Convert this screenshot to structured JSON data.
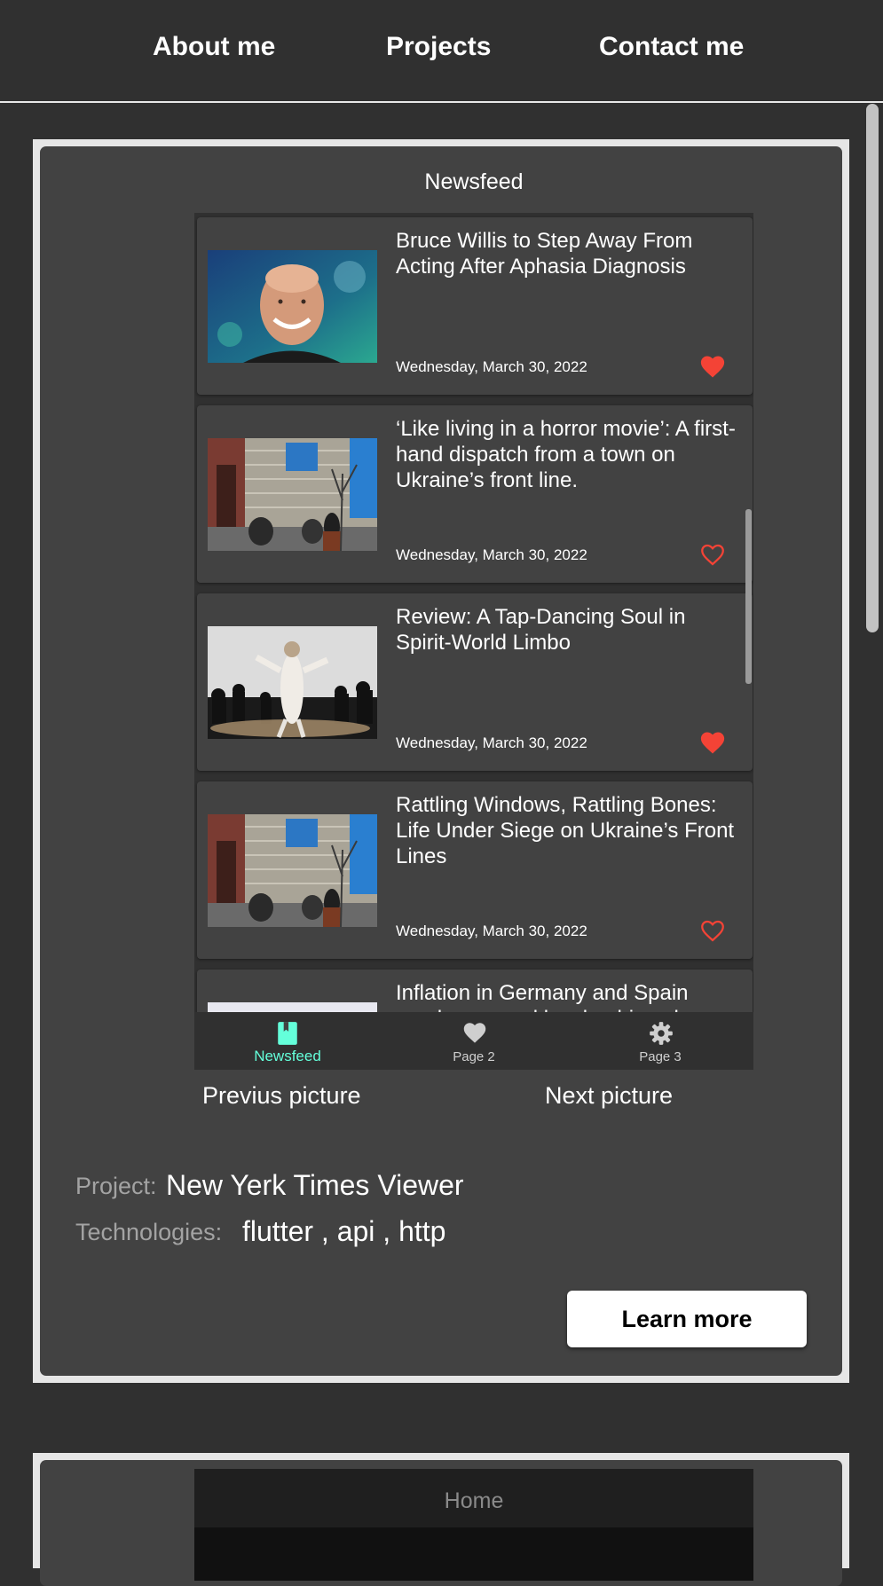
{
  "nav": {
    "about": "About me",
    "projects": "Projects",
    "contact": "Contact me"
  },
  "project1": {
    "app": {
      "title": "Newsfeed",
      "articles": [
        {
          "title": "Bruce Willis to Step Away From Acting After Aphasia Diagnosis",
          "date": "Wednesday, March 30, 2022",
          "liked": true
        },
        {
          "title": "‘Like living in a horror movie’: A first-hand dispatch from a town on Ukraine’s front line.",
          "date": "Wednesday, March 30, 2022",
          "liked": false
        },
        {
          "title": "Review: A Tap-Dancing Soul in Spirit-World Limbo",
          "date": "Wednesday, March 30, 2022",
          "liked": true
        },
        {
          "title": "Rattling Windows, Rattling Bones: Life Under Siege on Ukraine’s Front Lines",
          "date": "Wednesday, March 30, 2022",
          "liked": false
        },
        {
          "title": "Inflation in Germany and Spain reaches record levels, driven by",
          "date": "",
          "liked": false
        }
      ],
      "bottom_nav": {
        "newsfeed": "Newsfeed",
        "page2": "Page 2",
        "page3": "Page 3"
      }
    },
    "prev_label": "Previus picture",
    "next_label": "Next picture",
    "project_label": "Project:",
    "project_name": "New Yerk Times Viewer",
    "tech_label": "Technologies:",
    "tech_list": "flutter , api , http",
    "learn_more": "Learn more"
  },
  "project2": {
    "app_title": "Home"
  },
  "colors": {
    "accent": "#64ffda",
    "heart": "#f44336",
    "background": "#303030",
    "card": "#424242"
  }
}
